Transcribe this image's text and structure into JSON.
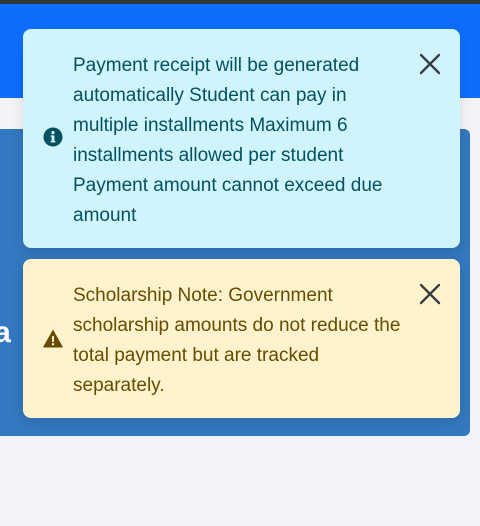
{
  "alerts": [
    {
      "type": "info",
      "icon": "info-circle-icon",
      "message": "Payment receipt will be generated automatically Student can pay in multiple installments Maximum 6 installments allowed per student Payment amount cannot exceed due amount",
      "close_icon": "close-icon",
      "color": "#055160",
      "background": "#cff4fc"
    },
    {
      "type": "warning",
      "icon": "warning-triangle-icon",
      "message": "Scholarship Note: Government scholarship amounts do not reduce the total payment but are tracked separately.",
      "close_icon": "close-icon",
      "color": "#664d03",
      "background": "#fff3cd"
    }
  ],
  "background": {
    "navbar_color": "#0d6efd",
    "card_color": "#3378c0",
    "partial_heading": "ra"
  }
}
